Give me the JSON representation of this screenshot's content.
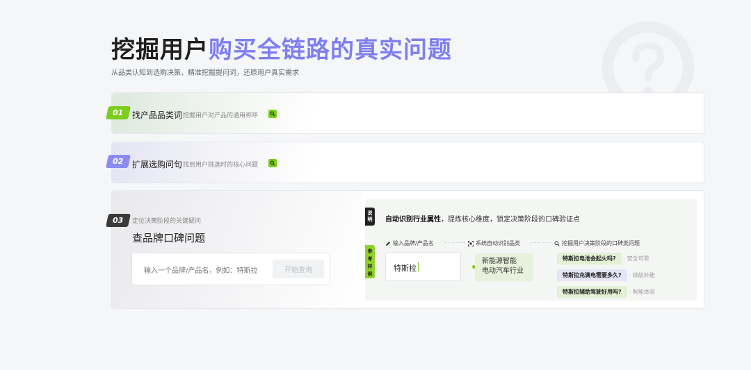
{
  "hero": {
    "title_dark": "挖掘用户",
    "title_accent": "购买全链路的真实问题",
    "subtitle": "从品类认知到选购决策，精准挖掘提问词，还原用户真实需求"
  },
  "steps": [
    {
      "num": "01",
      "title": "找产品品类词",
      "desc": "挖掘用户对产品的通用称呼",
      "icon": "search-icon"
    },
    {
      "num": "02",
      "title": "扩展选购问句",
      "desc": "找到用户挑选时的核心问题",
      "icon": "search-icon"
    },
    {
      "num": "03",
      "title": "查品牌口碑问题",
      "desc": "定位决策阶段的关键疑问"
    }
  ],
  "query": {
    "placeholder": "输入一个品牌/产品名，例如：特斯拉",
    "button": "开始查询"
  },
  "example": {
    "tag_note": "说\n明",
    "tag_example": "参\n考\n样\n例",
    "headline_bold": "自动识别行业属性",
    "headline_rest": "，提炼核心维度，锁定决策阶段的口碑验证点",
    "flow": [
      "输入品牌/产品名",
      "系统自动识别品类",
      "挖掘用户决策阶段的口碑类问题"
    ],
    "input_value": "特斯拉",
    "category": "新能源智能\n电动汽车行业",
    "questions": [
      {
        "q": "特斯拉电池会起火吗?",
        "tag": "· 安全可靠"
      },
      {
        "q": "特斯拉充满电需要多久?",
        "tag": "· 续航补能"
      },
      {
        "q": "特斯拉辅助驾驶好用吗?",
        "tag": "· 智能体验"
      }
    ]
  },
  "colors": {
    "accent": "#7f7ef0",
    "green": "#7ccd1c",
    "dark": "#3a3a3a"
  }
}
